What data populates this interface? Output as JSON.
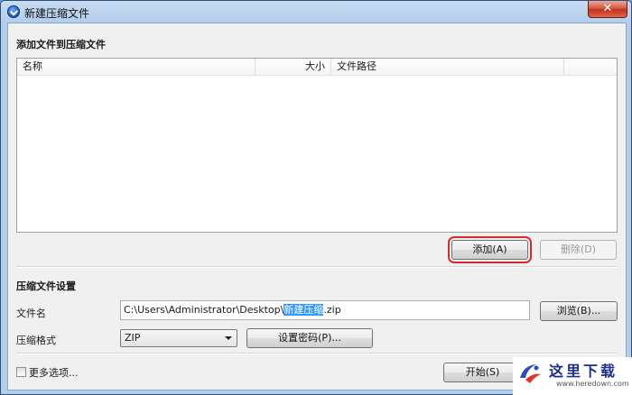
{
  "window": {
    "title": "新建压缩文件",
    "close_symbol": "✕"
  },
  "add_section": {
    "heading": "添加文件到压缩文件",
    "columns": [
      "名称",
      "大小",
      "文件路径"
    ],
    "rows": [],
    "add_button": "添加(A)",
    "delete_button": "删除(D)"
  },
  "settings_section": {
    "heading": "压缩文件设置",
    "filename_label": "文件名",
    "filename_prefix": "C:\\Users\\Administrator\\Desktop\\",
    "filename_selected": "新建压缩",
    "filename_suffix": ".zip",
    "browse_button": "浏览(B)...",
    "format_label": "压缩格式",
    "format_value": "ZIP",
    "password_button": "设置密码(P)..."
  },
  "footer": {
    "more_options_label": "更多选项...",
    "more_options_checked": false,
    "start_button": "开始(S)"
  },
  "watermark": {
    "title": "这里下载",
    "url": "www.heredown.com"
  },
  "colors": {
    "highlight_frame": "#d42b2b",
    "selection": "#3399ff"
  }
}
